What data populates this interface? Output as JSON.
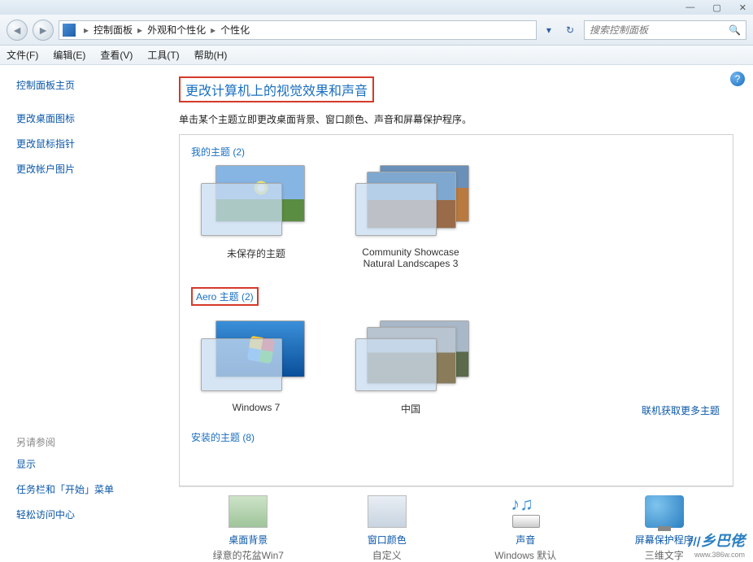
{
  "titlebar": {
    "min": "—",
    "max": "▢",
    "close": "✕"
  },
  "breadcrumb": {
    "items": [
      "控制面板",
      "外观和个性化",
      "个性化"
    ]
  },
  "search": {
    "placeholder": "搜索控制面板"
  },
  "menu": {
    "file": "文件(F)",
    "edit": "编辑(E)",
    "view": "查看(V)",
    "tools": "工具(T)",
    "help": "帮助(H)"
  },
  "sidebar": {
    "home": "控制面板主页",
    "links": [
      "更改桌面图标",
      "更改鼠标指针",
      "更改帐户图片"
    ],
    "seealso_hdr": "另请参阅",
    "seealso": [
      "显示",
      "任务栏和「开始」菜单",
      "轻松访问中心"
    ]
  },
  "content": {
    "heading": "更改计算机上的视觉效果和声音",
    "desc": "单击某个主题立即更改桌面背景、窗口颜色、声音和屏幕保护程序。",
    "section1": "我的主题 (2)",
    "themes1": [
      {
        "name": "未保存的主题"
      },
      {
        "name": "Community Showcase Natural Landscapes 3"
      }
    ],
    "more": "联机获取更多主题",
    "section2": "Aero 主题 (2)",
    "themes2": [
      {
        "name": "Windows 7"
      },
      {
        "name": "中国"
      }
    ],
    "section3": "安装的主题 (8)"
  },
  "bottom": [
    {
      "label": "桌面背景",
      "value": "绿意的花盆Win7"
    },
    {
      "label": "窗口颜色",
      "value": "自定义"
    },
    {
      "label": "声音",
      "value": "Windows 默认"
    },
    {
      "label": "屏幕保护程序",
      "value": "三维文字"
    }
  ],
  "watermark": {
    "text": "乡巴佬",
    "url": "www.386w.com"
  }
}
